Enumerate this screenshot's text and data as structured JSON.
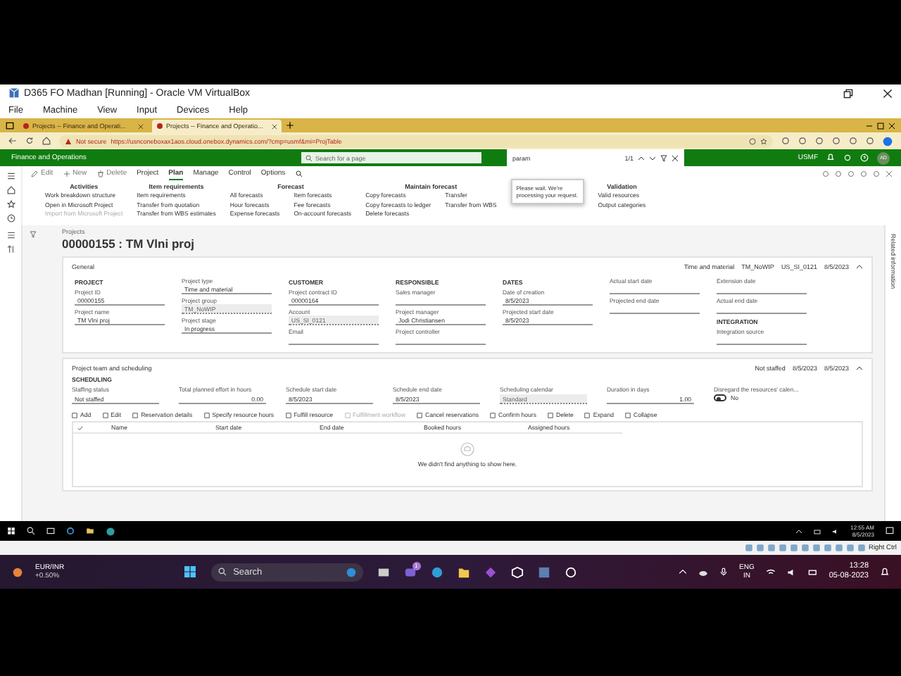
{
  "vm_window": {
    "title": "D365 FO Madhan [Running] - Oracle VM VirtualBox",
    "menu": [
      "File",
      "Machine",
      "View",
      "Input",
      "Devices",
      "Help"
    ]
  },
  "browser": {
    "tabs": [
      {
        "label": "Projects -- Finance and Operati...",
        "selected": false
      },
      {
        "label": "Projects -- Finance and Operatio...",
        "selected": true
      }
    ],
    "security": "Not secure",
    "url": "https://usnconeboxax1aos.cloud.onebox.dynamics.com/?cmp=usmf&mi=ProjTable"
  },
  "app_bar": {
    "title": "Finance and Operations",
    "search": {
      "placeholder": "Search for a page"
    },
    "find": {
      "value": "param",
      "count": "1/1"
    },
    "company": "USMF",
    "avatar": "AD"
  },
  "commands": [
    "Edit",
    "New",
    "Delete"
  ],
  "action_tabs": [
    {
      "label": "Project",
      "selected": false
    },
    {
      "label": "Plan",
      "selected": true
    },
    {
      "label": "Manage",
      "selected": false
    },
    {
      "label": "Control",
      "selected": false
    },
    {
      "label": "Options",
      "selected": false
    }
  ],
  "ribbon_groups": [
    {
      "title": "Activities",
      "items": [
        {
          "label": "Work breakdown structure",
          "disabled": false
        },
        {
          "label": "Open in Microsoft Project",
          "disabled": false
        },
        {
          "label": "Import from Microsoft Project",
          "disabled": true
        }
      ]
    },
    {
      "title": "Item requirements",
      "items": [
        {
          "label": "Item requirements",
          "disabled": false
        },
        {
          "label": "Transfer from quotation",
          "disabled": false
        },
        {
          "label": "Transfer from WBS estimates",
          "disabled": false
        }
      ]
    },
    {
      "title": "Forecast",
      "items": [
        {
          "label": "All forecasts",
          "disabled": false
        },
        {
          "label": "Hour forecasts",
          "disabled": false
        },
        {
          "label": "Expense forecasts",
          "disabled": false
        },
        {
          "label": "Item forecasts",
          "disabled": false
        },
        {
          "label": "Fee forecasts",
          "disabled": false
        },
        {
          "label": "On-account forecasts",
          "disabled": false
        }
      ]
    },
    {
      "title": "Maintain forecast",
      "items": [
        {
          "label": "Copy forecasts",
          "disabled": false
        },
        {
          "label": "Copy forecasts to ledger",
          "disabled": false
        },
        {
          "label": "Delete forecasts",
          "disabled": false
        },
        {
          "label": "Transfer",
          "disabled": false
        },
        {
          "label": "Transfer from WBS",
          "disabled": false
        }
      ]
    },
    {
      "title": "Validation",
      "items": [
        {
          "label": "Valid resources",
          "disabled": false
        },
        {
          "label": "Output categories",
          "disabled": false
        }
      ]
    }
  ],
  "notice": "Please wait. We're processing your request.",
  "page": {
    "breadcrumb": "Projects",
    "title": "00000155 : TM Vlni proj",
    "side_panel": "Related information"
  },
  "general": {
    "title": "General",
    "summary": [
      "Time and material",
      "TM_NoWIP",
      "US_SI_0121",
      "8/5/2023"
    ],
    "columns": [
      [
        {
          "kind": "heading",
          "text": "PROJECT"
        },
        {
          "kind": "field",
          "label": "Project ID",
          "value": "00000155",
          "disabled": false
        },
        {
          "kind": "field",
          "label": "Project name",
          "value": "TM Vlni proj",
          "disabled": false
        }
      ],
      [
        {
          "kind": "field",
          "label": "Project type",
          "value": "Time and material",
          "disabled": false
        },
        {
          "kind": "field",
          "label": "Project group",
          "value": "TM_NoWIP",
          "disabled": true
        },
        {
          "kind": "field",
          "label": "Project stage",
          "value": "In progress",
          "disabled": false
        }
      ],
      [
        {
          "kind": "heading",
          "text": "CUSTOMER"
        },
        {
          "kind": "field",
          "label": "Project contract ID",
          "value": "00000164",
          "disabled": false
        },
        {
          "kind": "field",
          "label": "Account",
          "value": "US_SI_0121",
          "disabled": true
        },
        {
          "kind": "field",
          "label": "Email",
          "disabled": false
        }
      ],
      [
        {
          "kind": "heading",
          "text": "RESPONSIBLE"
        },
        {
          "kind": "field",
          "label": "Sales manager",
          "disabled": false
        },
        {
          "kind": "field",
          "label": "Project manager",
          "value": "Jodi Christiansen",
          "disabled": false
        },
        {
          "kind": "field",
          "label": "Project controller",
          "disabled": false
        }
      ],
      [
        {
          "kind": "heading",
          "text": "DATES"
        },
        {
          "kind": "field",
          "label": "Date of creation",
          "value": "8/5/2023",
          "disabled": false
        },
        {
          "kind": "field",
          "label": "Projected start date",
          "value": "8/5/2023",
          "disabled": false
        }
      ],
      [
        {
          "kind": "field",
          "label": "Actual start date",
          "disabled": false
        },
        {
          "kind": "field",
          "label": "Projected end date",
          "disabled": false
        }
      ],
      [
        {
          "kind": "field",
          "label": "Extension date",
          "disabled": false
        },
        {
          "kind": "field",
          "label": "Actual end date",
          "disabled": false
        },
        {
          "kind": "heading",
          "text": "INTEGRATION"
        },
        {
          "kind": "field",
          "label": "Integration source",
          "disabled": false
        }
      ]
    ]
  },
  "team": {
    "title": "Project team and scheduling",
    "summary": [
      "Not staffed",
      "8/5/2023",
      "8/5/2023"
    ],
    "heading": "SCHEDULING",
    "fields": [
      {
        "kind": "field",
        "label": "Staffing status",
        "value": "Not staffed",
        "disabled": false
      },
      {
        "kind": "number",
        "label": "Total planned effort in hours",
        "value": "0.00",
        "disabled": false
      },
      {
        "kind": "field",
        "label": "Schedule start date",
        "value": "8/5/2023",
        "disabled": false
      },
      {
        "kind": "field",
        "label": "Schedule end date",
        "value": "8/5/2023",
        "disabled": false
      },
      {
        "kind": "field",
        "label": "Scheduling calendar",
        "value": "Standard",
        "disabled": true
      },
      {
        "kind": "number",
        "label": "Duration in days",
        "value": "1.00",
        "disabled": false
      },
      {
        "kind": "toggle",
        "label": "Disregard the resources' calen...",
        "value": "No",
        "on": false
      }
    ]
  },
  "grid_toolbar": [
    {
      "label": "Add",
      "disabled": false
    },
    {
      "label": "Edit",
      "disabled": false
    },
    {
      "label": "Reservation details",
      "disabled": false
    },
    {
      "label": "Specify resource hours",
      "disabled": false
    },
    {
      "label": "Fulfill resource",
      "disabled": false
    },
    {
      "label": "Fulfillment workflow",
      "disabled": true
    },
    {
      "label": "Cancel reservations",
      "disabled": false
    },
    {
      "label": "Confirm hours",
      "disabled": false
    },
    {
      "label": "Delete",
      "disabled": false
    },
    {
      "label": "Expand",
      "disabled": false
    },
    {
      "label": "Collapse",
      "disabled": false
    }
  ],
  "grid": {
    "columns": [
      "Name",
      "Start date",
      "End date",
      "Booked hours",
      "Assigned hours"
    ],
    "empty_text": "We didn't find anything to show here."
  },
  "guest_taskbar": {
    "time": "12:55 AM",
    "date": "8/5/2023"
  },
  "vbox_status": {
    "host_key": "Right Ctrl"
  },
  "host_taskbar": {
    "ticker": {
      "name": "EUR/INR",
      "change": "+0.50%"
    },
    "search": {
      "placeholder": "Search"
    },
    "chat_badge": "1",
    "language": [
      "ENG",
      "IN"
    ],
    "time": "13:28",
    "date": "05-08-2023"
  }
}
